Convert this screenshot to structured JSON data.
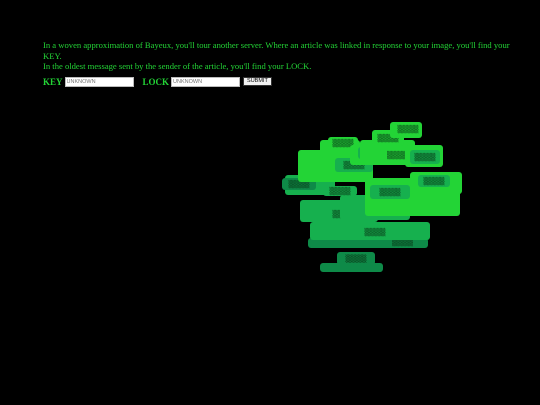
{
  "intro": {
    "line1": "In a woven approximation of Bayeux, you'll tour another server. Where an article was linked in response to your image, you'll find your KEY.",
    "line2": "In the oldest message sent by the sender of the article, you'll find your LOCK."
  },
  "form": {
    "key_label": "KEY",
    "key_placeholder": "UNKNOWN",
    "lock_label": "LOCK",
    "lock_placeholder": "UNKNOWN",
    "submit_label": "SUBMIT"
  },
  "tree": {
    "node_label": "▒▒▒▒▒",
    "colors": {
      "bright": "#23d436",
      "mid": "#16b04e",
      "dark": "#0e8a48"
    }
  }
}
